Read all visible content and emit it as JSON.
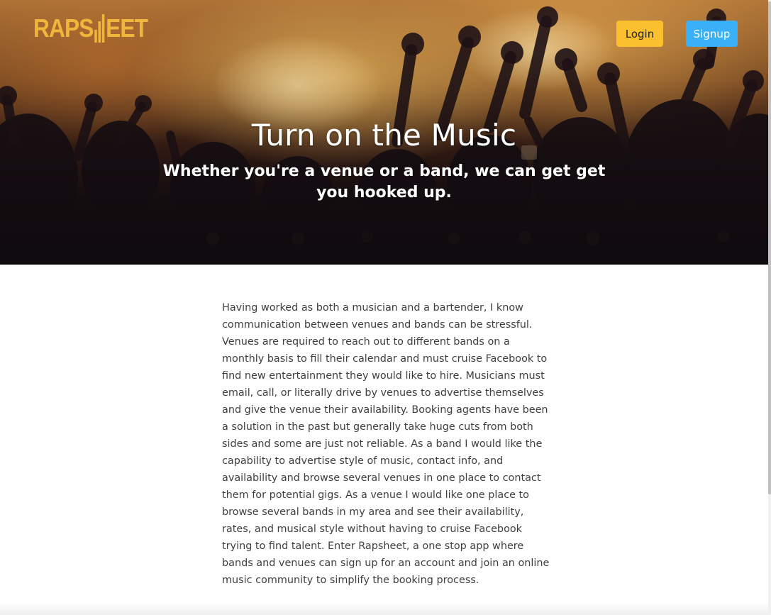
{
  "header": {
    "logo_text": "RAPSHEET",
    "login_label": "Login",
    "signup_label": "Signup"
  },
  "hero": {
    "title": "Turn on the Music",
    "subtitle": "Whether you're a venue or a band, we can get get you hooked up."
  },
  "about": {
    "text": "Having worked as both a musician and a bartender, I know communication between venues and bands can be stressful. Venues are required to reach out to different bands on a monthly basis to fill their calendar and must cruise Facebook to find new entertainment they would like to hire. Musicians must email, call, or literally drive by venues to advertise themselves and give the venue their availability. Booking agents have been a solution in the past but generally take huge cuts from both sides and some are just not reliable. As a band I would like the capability to advertise style of music, contact info, and availability and browse several venues in one place to contact them for potential gigs. As a venue I would like one place to browse several bands in my area and see their availability, rates, and musical style without having to cruise Facebook trying to find talent. Enter Rapsheet, a one stop app where bands and venues can sign up for an account and join an online music community to simplify the booking process."
  },
  "colors": {
    "logo": "#f0b53b",
    "login_button": "#fbc02d",
    "signup_button": "#3ab0f6",
    "body_text": "#3f3f3f"
  },
  "icons": {
    "logo_equalizer": "equalizer-bars-icon"
  }
}
